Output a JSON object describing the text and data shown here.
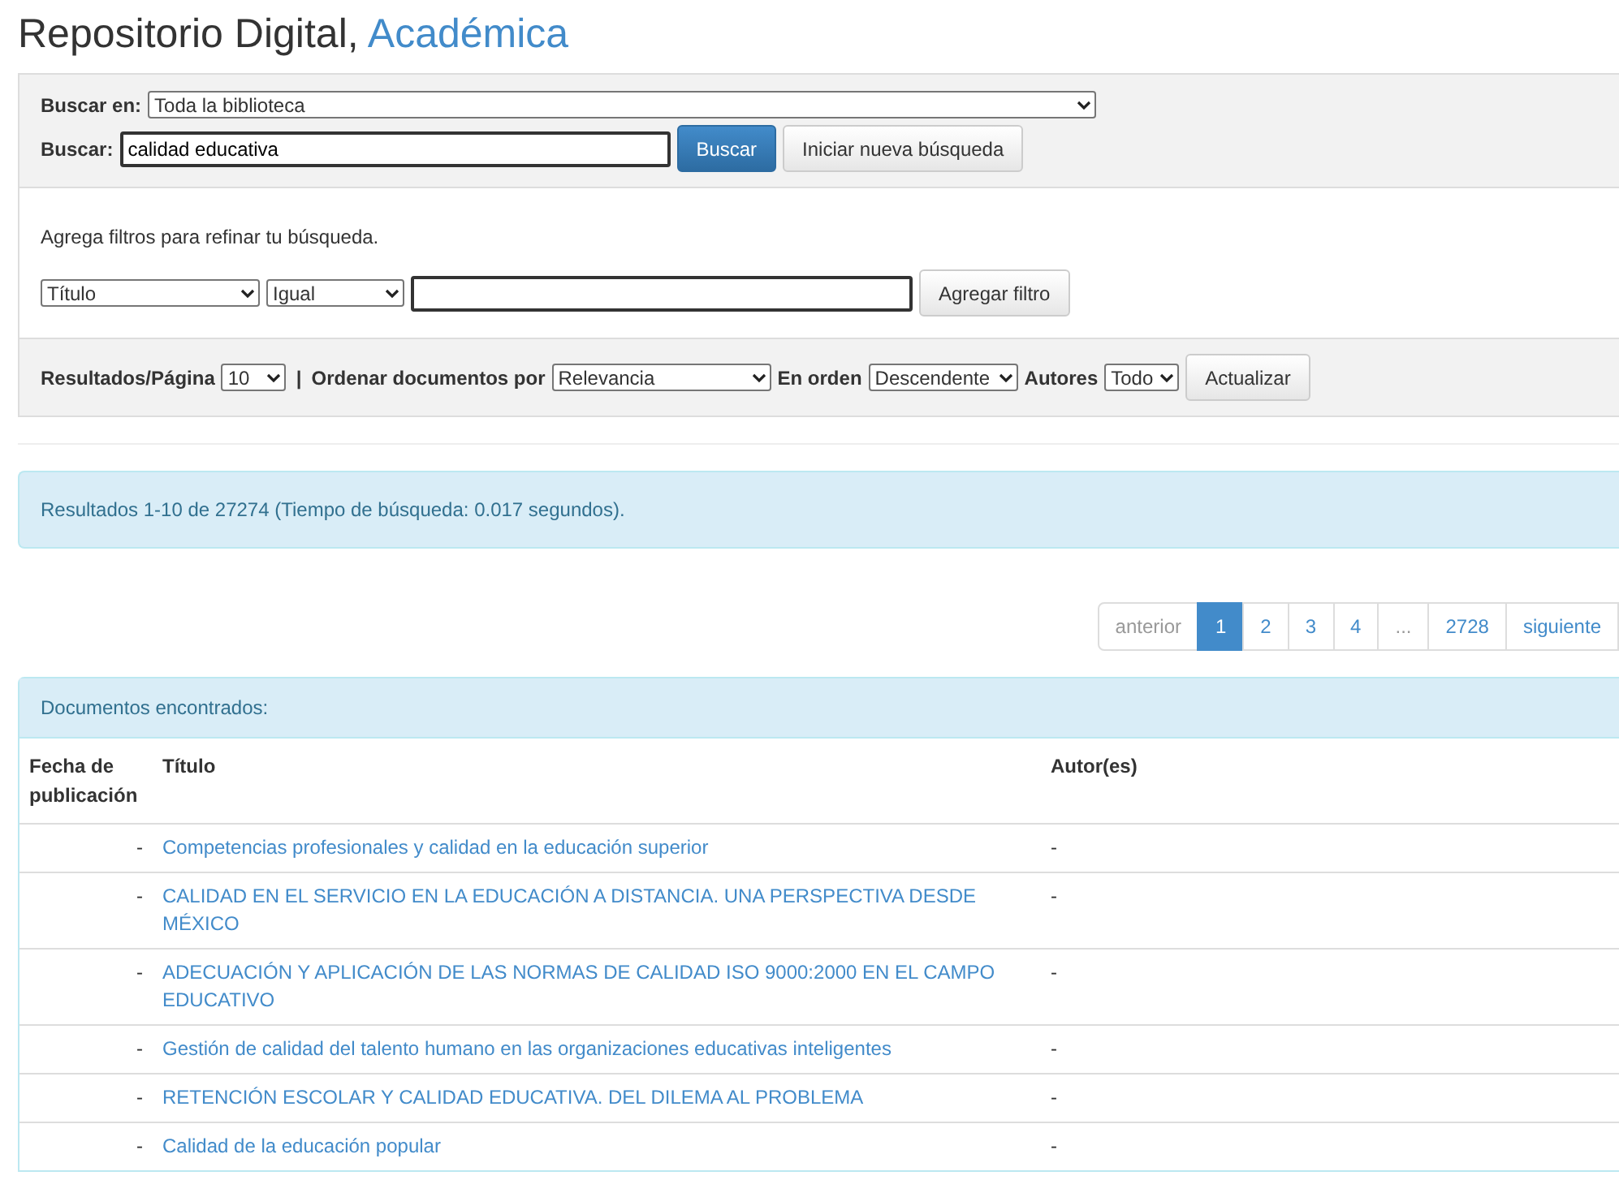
{
  "title": {
    "main": "Repositorio Digital,",
    "accent": "Académica"
  },
  "search": {
    "scope_label": "Buscar en:",
    "scope_value": "Toda la biblioteca",
    "query_label": "Buscar:",
    "query_value": "calidad educativa",
    "buttons": [
      {
        "label": "Buscar",
        "kind": "primary"
      },
      {
        "label": "Iniciar nueva búsqueda",
        "kind": "default"
      }
    ]
  },
  "filters": {
    "hint": "Agrega filtros para refinar tu búsqueda.",
    "field": "Título",
    "operator": "Igual",
    "button": "Agregar filtro"
  },
  "options": {
    "per_page_label": "Resultados/Página",
    "per_page": "10",
    "separator": "|",
    "sort_label": "Ordenar documentos por",
    "sort": "Relevancia",
    "order_label": "En orden",
    "order": "Descendente",
    "authors_label": "Autores",
    "authors": "Todo",
    "button": "Actualizar"
  },
  "results_info": "Resultados 1-10 de 27274 (Tiempo de búsqueda: 0.017 segundos).",
  "pagination": [
    {
      "label": "anterior",
      "kind": "disabled",
      "selected": false
    },
    {
      "label": "1",
      "kind": "page",
      "selected": true
    },
    {
      "label": "2",
      "kind": "page",
      "selected": false
    },
    {
      "label": "3",
      "kind": "page",
      "selected": false
    },
    {
      "label": "4",
      "kind": "page",
      "selected": false
    },
    {
      "label": "...",
      "kind": "disabled",
      "selected": false
    },
    {
      "label": "2728",
      "kind": "page",
      "selected": false
    },
    {
      "label": "siguiente",
      "kind": "page",
      "selected": false
    }
  ],
  "documents": {
    "heading": "Documentos encontrados:",
    "columns": [
      "Fecha de publicación",
      "Título",
      "Autor(es)"
    ],
    "rows": [
      {
        "date": "-",
        "title": "Competencias profesionales y calidad en la educación superior",
        "authors": "-"
      },
      {
        "date": "-",
        "title": "CALIDAD EN EL SERVICIO EN LA EDUCACIÓN A DISTANCIA. UNA PERSPECTIVA DESDE MÉXICO",
        "authors": "-"
      },
      {
        "date": "-",
        "title": "ADECUACIÓN Y APLICACIÓN DE LAS NORMAS DE CALIDAD ISO 9000:2000 EN EL CAMPO EDUCATIVO",
        "authors": "-"
      },
      {
        "date": "-",
        "title": "Gestión de calidad del talento humano en las organizaciones educativas inteligentes",
        "authors": "-"
      },
      {
        "date": "-",
        "title": "RETENCIÓN ESCOLAR Y CALIDAD EDUCATIVA. DEL DILEMA AL PROBLEMA",
        "authors": "-"
      },
      {
        "date": "-",
        "title": "Calidad de la educación popular",
        "authors": "-"
      }
    ]
  }
}
